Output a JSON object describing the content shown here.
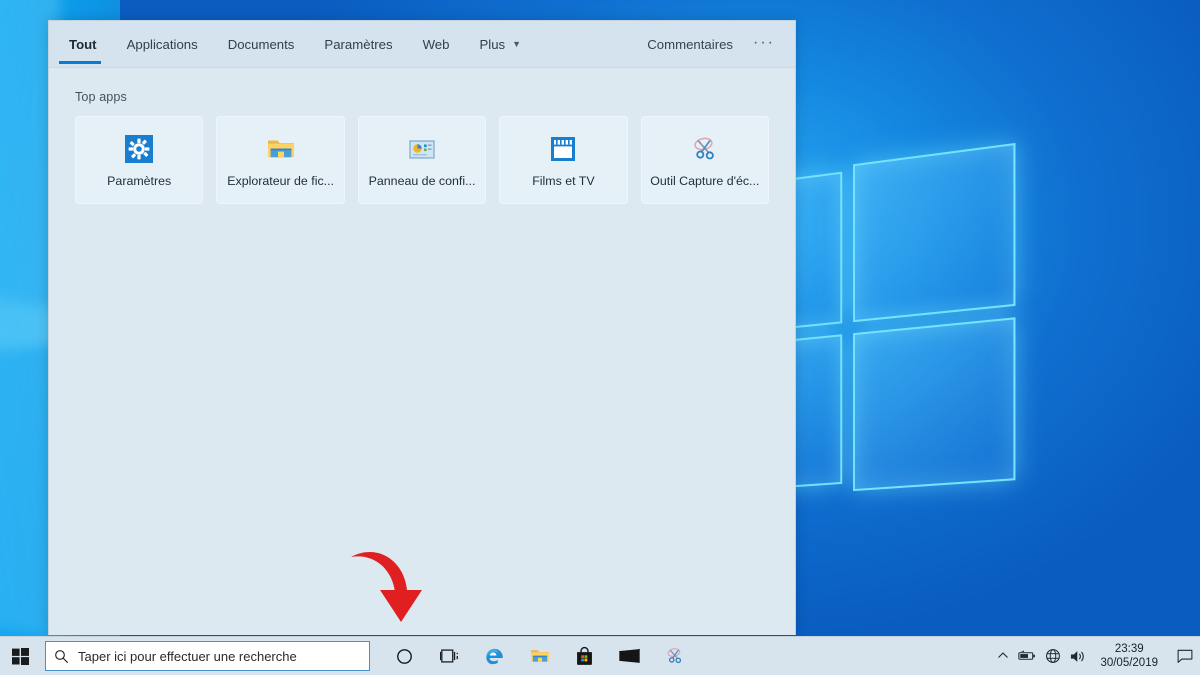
{
  "desktop": {
    "wallpaper_name": "windows-10-hero-wallpaper",
    "colors": {
      "accent": "#0a7bd4",
      "wall_blue": "#0d6fd2",
      "panel_bg": "#dde9f1",
      "tile_bg": "#e6f0f7",
      "taskbar_bg": "#d7e3ed"
    }
  },
  "search_panel": {
    "tabs": [
      {
        "label": "Tout",
        "active": true,
        "has_caret": false
      },
      {
        "label": "Applications",
        "active": false,
        "has_caret": false
      },
      {
        "label": "Documents",
        "active": false,
        "has_caret": false
      },
      {
        "label": "Paramètres",
        "active": false,
        "has_caret": false
      },
      {
        "label": "Web",
        "active": false,
        "has_caret": false
      },
      {
        "label": "Plus",
        "active": false,
        "has_caret": true
      }
    ],
    "caret_glyph": "▼",
    "feedback_label": "Commentaires",
    "more_options_label": "···",
    "section_title": "Top apps",
    "tiles": [
      {
        "label": "Paramètres",
        "icon": "settings-gear-icon"
      },
      {
        "label": "Explorateur de fic...",
        "icon": "file-explorer-folder-icon"
      },
      {
        "label": "Panneau de confi...",
        "icon": "control-panel-icon"
      },
      {
        "label": "Films et TV",
        "icon": "movies-tv-clapperboard-icon"
      },
      {
        "label": "Outil Capture d'éc...",
        "icon": "snipping-tool-scissors-icon"
      }
    ]
  },
  "annotation": {
    "arrow": "red-curved-down-arrow",
    "color": "#e02020"
  },
  "taskbar": {
    "start_label": "Démarrer",
    "search": {
      "placeholder": "Taper ici pour effectuer une recherche",
      "value": "",
      "icon": "search-magnifier-icon"
    },
    "buttons": [
      {
        "name": "cortana-circle-icon",
        "label": "Cortana"
      },
      {
        "name": "task-view-icon",
        "label": "Affichage des tâches"
      },
      {
        "name": "edge-browser-icon",
        "label": "Microsoft Edge"
      },
      {
        "name": "file-explorer-icon",
        "label": "Explorateur de fichiers"
      },
      {
        "name": "microsoft-store-icon",
        "label": "Microsoft Store"
      },
      {
        "name": "mail-envelope-icon",
        "label": "Courrier"
      },
      {
        "name": "snipping-tool-icon",
        "label": "Outil Capture d'écran"
      }
    ],
    "tray": {
      "icons": [
        {
          "name": "show-hidden-icons-chevron",
          "glyph": "⌃"
        },
        {
          "name": "battery-icon"
        },
        {
          "name": "network-globe-icon"
        },
        {
          "name": "volume-speaker-icon"
        }
      ],
      "time": "23:39",
      "date": "30/05/2019",
      "action_center": "action-center-icon"
    }
  }
}
